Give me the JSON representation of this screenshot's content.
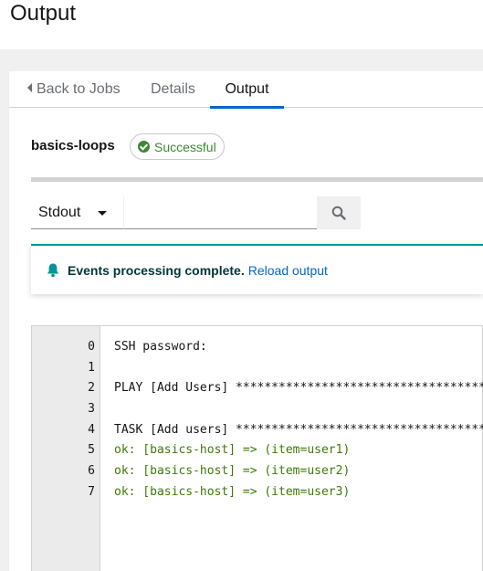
{
  "page": {
    "title": "Output"
  },
  "tabs": {
    "back": "Back to Jobs",
    "details": "Details",
    "output": "Output"
  },
  "job": {
    "name": "basics-loops",
    "status": "Successful"
  },
  "filter": {
    "select_value": "Stdout",
    "search_placeholder": ""
  },
  "alert": {
    "message": "Events processing complete.",
    "link": "Reload output"
  },
  "log": [
    {
      "n": "0",
      "text": "SSH password:",
      "kind": "plain"
    },
    {
      "n": "1",
      "text": "",
      "kind": "plain"
    },
    {
      "n": "2",
      "text": "PLAY [Add Users] ******************************************",
      "kind": "plain"
    },
    {
      "n": "3",
      "text": "",
      "kind": "plain"
    },
    {
      "n": "4",
      "text": "TASK [Add users] ******************************************",
      "kind": "plain"
    },
    {
      "n": "5",
      "text": "ok: [basics-host] => (item=user1)",
      "kind": "ok"
    },
    {
      "n": "6",
      "text": "ok: [basics-host] => (item=user2)",
      "kind": "ok"
    },
    {
      "n": "7",
      "text": "ok: [basics-host] => (item=user3)",
      "kind": "ok"
    }
  ],
  "colors": {
    "accent": "#0066cc",
    "success": "#3e8635",
    "alert_border": "#009596",
    "ok_text": "#3e7a07"
  }
}
